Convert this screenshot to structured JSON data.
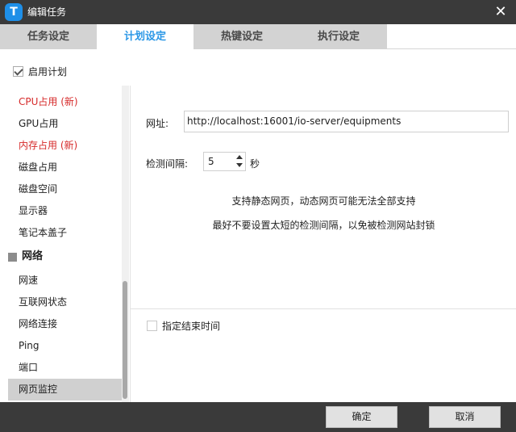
{
  "window": {
    "title": "编辑任务",
    "logo_letter": "T",
    "close_symbol": "✕"
  },
  "tabs": [
    {
      "label": "任务设定",
      "active": false
    },
    {
      "label": "计划设定",
      "active": true
    },
    {
      "label": "热键设定",
      "active": false
    },
    {
      "label": "执行设定",
      "active": false
    }
  ],
  "enable_schedule": {
    "label": "启用计划",
    "checked": true
  },
  "sidebar": {
    "items": [
      {
        "label": "CPU占用 (新)",
        "color": "#d62a2a"
      },
      {
        "label": "GPU占用"
      },
      {
        "label": "内存占用 (新)",
        "color": "#d62a2a"
      },
      {
        "label": "磁盘占用"
      },
      {
        "label": "磁盘空间"
      },
      {
        "label": "显示器"
      },
      {
        "label": "笔记本盖子"
      }
    ],
    "group": {
      "label": "网络"
    },
    "group_items": [
      {
        "label": "网速"
      },
      {
        "label": "互联网状态"
      },
      {
        "label": "网络连接"
      },
      {
        "label": "Ping"
      },
      {
        "label": "端口"
      },
      {
        "label": "网页监控",
        "selected": true
      }
    ]
  },
  "content": {
    "url_label": "网址:",
    "url_value": "http://localhost:16001/io-server/equipments",
    "interval_label": "检测间隔:",
    "interval_value": "5",
    "interval_unit": "秒",
    "hint_line1": "支持静态网页，动态网页可能无法全部支持",
    "hint_line2": "最好不要设置太短的检测间隔，以免被检测网站封锁",
    "end_time": {
      "label": "指定结束时间",
      "checked": false
    }
  },
  "footer": {
    "ok_label": "确定",
    "cancel_label": "取消"
  },
  "colors": {
    "accent": "#2b97e6",
    "titlebar": "#3a3a3a",
    "highlight_text": "#d62a2a"
  }
}
